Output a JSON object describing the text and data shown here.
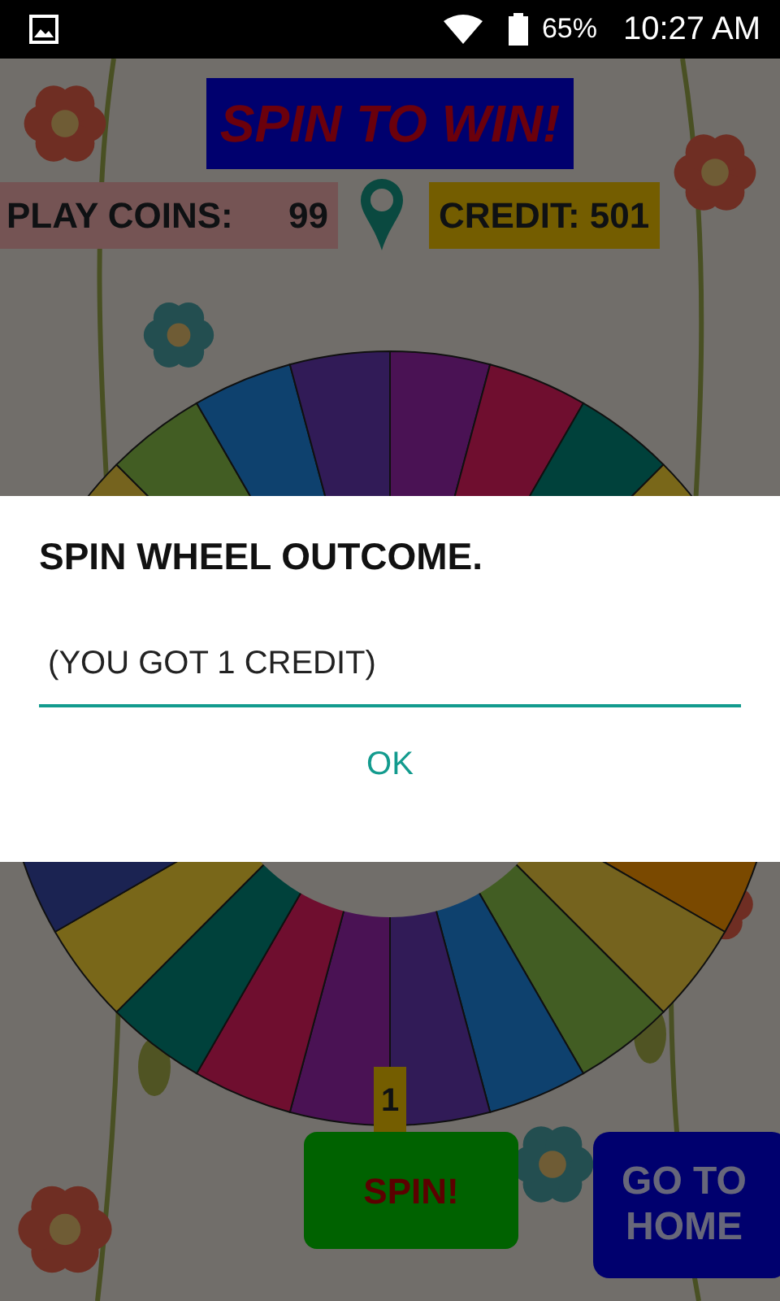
{
  "status_bar": {
    "battery": "65%",
    "time": "10:27 AM"
  },
  "title": "SPIN TO WIN!",
  "play_coins": {
    "label": "PLAY COINS:",
    "value": "99"
  },
  "credit": "CREDIT: 501",
  "pointer_value": "1",
  "buttons": [
    {
      "kind": "spin",
      "label": "SPIN!"
    },
    {
      "kind": "home",
      "label": "GO TO HOME"
    }
  ],
  "dialog": {
    "title": "SPIN WHEEL OUTCOME.",
    "message": " (YOU GOT 1 CREDIT)",
    "button": "OK"
  }
}
